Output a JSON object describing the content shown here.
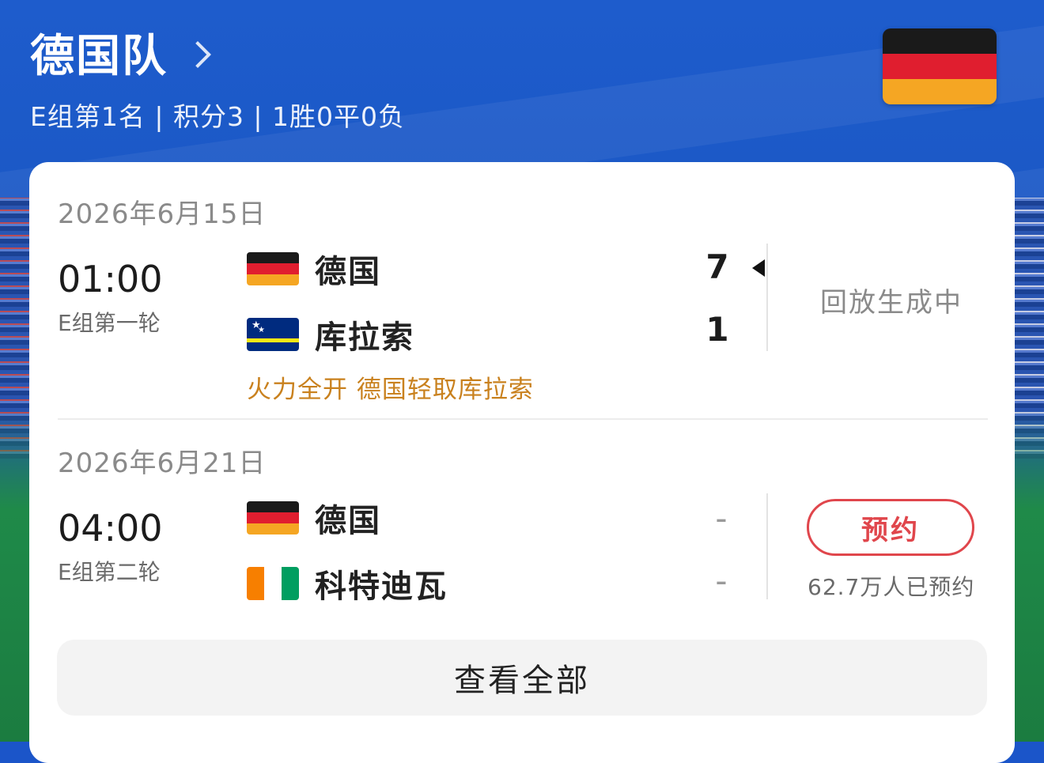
{
  "team": {
    "name": "德国队",
    "summary": "E组第1名 | 积分3 | 1胜0平0负"
  },
  "matches": [
    {
      "date": "2026年6月15日",
      "time": "01:00",
      "round": "E组第一轮",
      "home": {
        "name": "德国",
        "score": "7",
        "flag": "germany-flag"
      },
      "away": {
        "name": "库拉索",
        "score": "1",
        "flag": "curacao-flag"
      },
      "status": "回放生成中",
      "headline": "火力全开 德国轻取库拉索"
    },
    {
      "date": "2026年6月21日",
      "time": "04:00",
      "round": "E组第二轮",
      "home": {
        "name": "德国",
        "score": "-",
        "flag": "germany-flag"
      },
      "away": {
        "name": "科特迪瓦",
        "score": "-",
        "flag": "ivory-coast-flag"
      },
      "reserve_label": "预约",
      "reserve_count": "62.7万人已预约"
    }
  ],
  "view_all_label": "查看全部",
  "colors": {
    "accent_red": "#e0464c",
    "headline_orange": "#c9811e",
    "header_blue": "#1e5ccc"
  }
}
